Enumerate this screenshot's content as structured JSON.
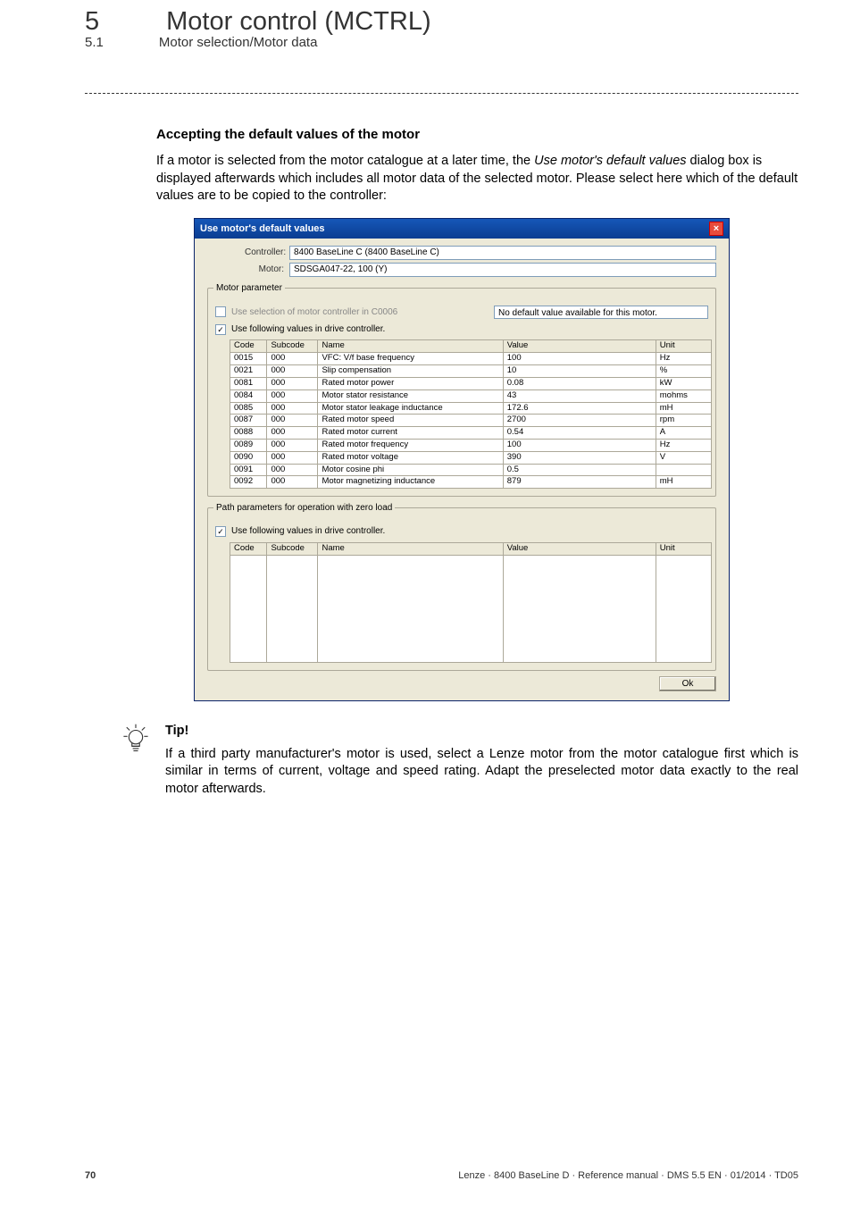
{
  "chapter": {
    "number": "5",
    "title": "Motor control (MCTRL)"
  },
  "subchapter": {
    "number": "5.1",
    "title": "Motor selection/Motor data"
  },
  "section_heading": "Accepting the default values of the motor",
  "intro_text_pre": "If a motor is selected from the motor catalogue at a later time, the ",
  "intro_text_em": "Use motor's default values",
  "intro_text_post": " dialog box is displayed afterwards which includes all motor data of the selected motor. Please select here which of the default values are to be copied to the controller:",
  "dialog": {
    "title": "Use motor's default values",
    "controller_label": "Controller:",
    "controller_value": "8400 BaseLine C (8400 BaseLine C)",
    "motor_label": "Motor:",
    "motor_value": "SDSGA047-22, 100 (Y)",
    "group1": {
      "title": "Motor parameter",
      "cb_disabled": "Use selection of motor controller in C0006",
      "msg": "No default value available for this motor.",
      "cb_use": "Use following values in drive controller.",
      "headers": {
        "code": "Code",
        "subcode": "Subcode",
        "name": "Name",
        "value": "Value",
        "unit": "Unit"
      },
      "rows": [
        {
          "code": "0015",
          "sub": "000",
          "name": "VFC: V/f base frequency",
          "value": "100",
          "unit": "Hz"
        },
        {
          "code": "0021",
          "sub": "000",
          "name": "Slip compensation",
          "value": "10",
          "unit": "%"
        },
        {
          "code": "0081",
          "sub": "000",
          "name": "Rated motor power",
          "value": "0.08",
          "unit": "kW"
        },
        {
          "code": "0084",
          "sub": "000",
          "name": "Motor stator resistance",
          "value": "43",
          "unit": "mohms"
        },
        {
          "code": "0085",
          "sub": "000",
          "name": "Motor stator leakage inductance",
          "value": "172.6",
          "unit": "mH"
        },
        {
          "code": "0087",
          "sub": "000",
          "name": "Rated motor speed",
          "value": "2700",
          "unit": "rpm"
        },
        {
          "code": "0088",
          "sub": "000",
          "name": "Rated motor current",
          "value": "0.54",
          "unit": "A"
        },
        {
          "code": "0089",
          "sub": "000",
          "name": "Rated motor frequency",
          "value": "100",
          "unit": "Hz"
        },
        {
          "code": "0090",
          "sub": "000",
          "name": "Rated motor voltage",
          "value": "390",
          "unit": "V"
        },
        {
          "code": "0091",
          "sub": "000",
          "name": "Motor cosine phi",
          "value": "0.5",
          "unit": ""
        },
        {
          "code": "0092",
          "sub": "000",
          "name": "Motor magnetizing inductance",
          "value": "879",
          "unit": "mH"
        }
      ]
    },
    "group2": {
      "title": "Path parameters for operation with zero load",
      "cb_use": "Use following values in drive controller."
    },
    "ok": "Ok"
  },
  "tip": {
    "label": "Tip!",
    "text": "If a third party manufacturer's motor is used, select a Lenze motor from the motor catalogue first which is similar in terms of current, voltage and speed rating. Adapt the preselected motor data exactly to the real motor afterwards."
  },
  "footer": {
    "page": "70",
    "info": "Lenze · 8400 BaseLine D · Reference manual · DMS 5.5 EN · 01/2014 · TD05"
  }
}
